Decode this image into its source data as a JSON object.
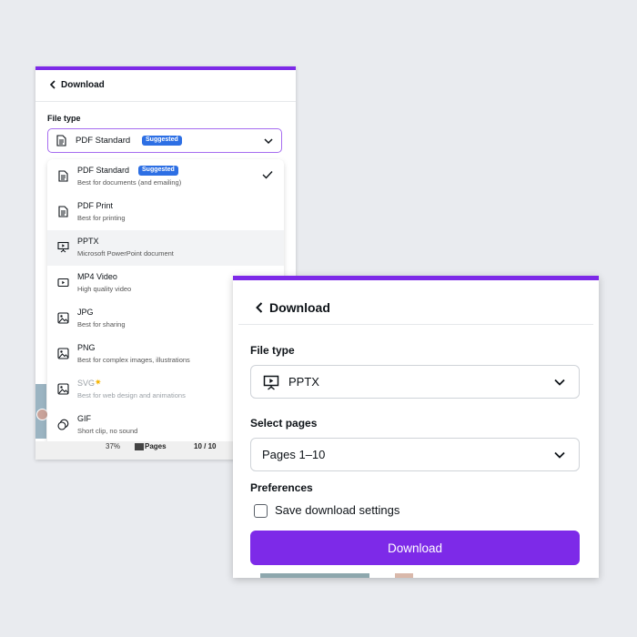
{
  "panel1": {
    "title": "Download",
    "file_type_label": "File type",
    "selected_value": "PDF Standard",
    "selected_badge": "Suggested",
    "options": [
      {
        "title": "PDF Standard",
        "desc": "Best for documents (and emailing)",
        "badge": "Suggested",
        "icon": "document-icon",
        "checked": true
      },
      {
        "title": "PDF Print",
        "desc": "Best for printing",
        "icon": "document-icon"
      },
      {
        "title": "PPTX",
        "desc": "Microsoft PowerPoint document",
        "icon": "presentation-icon",
        "highlighted": true
      },
      {
        "title": "MP4 Video",
        "desc": "High quality video",
        "icon": "video-icon"
      },
      {
        "title": "JPG",
        "desc": "Best for sharing",
        "icon": "image-icon"
      },
      {
        "title": "PNG",
        "desc": "Best for complex images, illustrations",
        "icon": "image-icon"
      },
      {
        "title": "SVG",
        "desc": "Best for web design and animations",
        "icon": "image-icon",
        "pro": true,
        "dimmed": true
      },
      {
        "title": "GIF",
        "desc": "Short clip, no sound",
        "icon": "gif-icon"
      }
    ],
    "footer": {
      "zoom": "37%",
      "pages_label": "Pages",
      "page_count": "10 / 10"
    }
  },
  "panel2": {
    "title": "Download",
    "file_type_label": "File type",
    "file_type_value": "PPTX",
    "select_pages_label": "Select pages",
    "select_pages_value": "Pages 1–10",
    "preferences_label": "Preferences",
    "save_settings_label": "Save download settings",
    "save_settings_checked": false,
    "download_button": "Download"
  },
  "colors": {
    "accent": "#7d2ae8",
    "badge": "#2d6fe4",
    "background": "#e9ebef"
  }
}
